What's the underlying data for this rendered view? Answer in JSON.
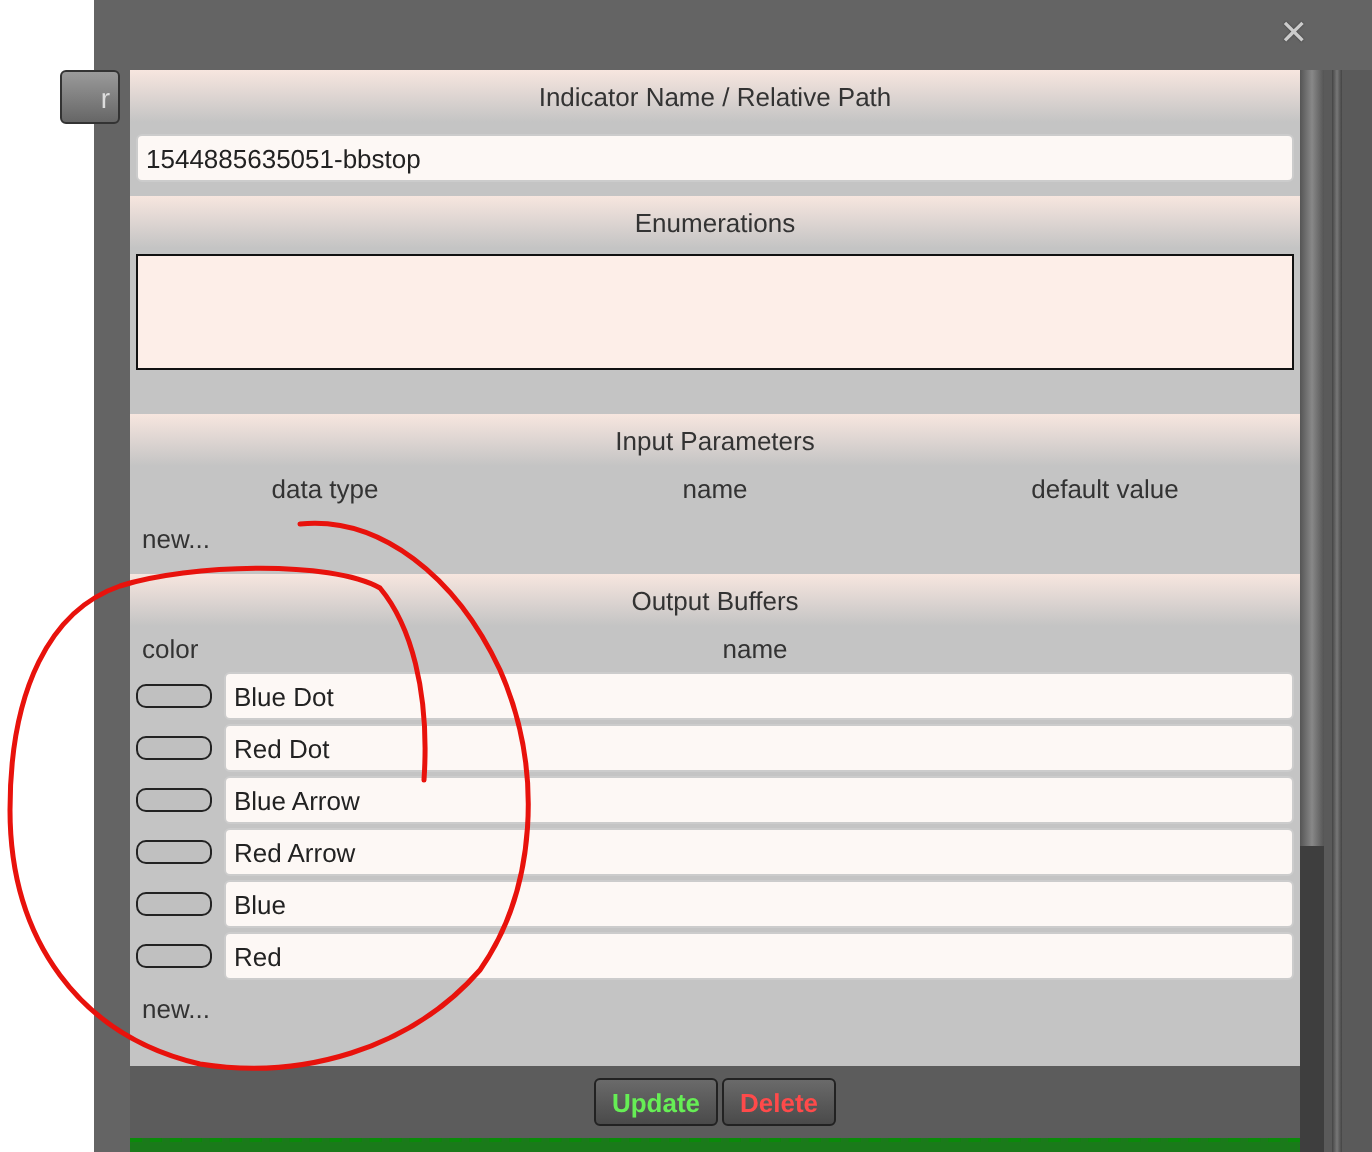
{
  "background_button": {
    "label": "r"
  },
  "dialog": {
    "close": "✕"
  },
  "indicator": {
    "title": "Indicator Name / Relative Path",
    "value": "1544885635051-bbstop"
  },
  "enumerations": {
    "title": "Enumerations"
  },
  "input_parameters": {
    "title": "Input Parameters",
    "columns": [
      "data type",
      "name",
      "default value"
    ],
    "new_link": "new..."
  },
  "output_buffers": {
    "title": "Output Buffers",
    "columns": [
      "color",
      "name"
    ],
    "rows": [
      {
        "name": "Blue Dot"
      },
      {
        "name": "Red Dot"
      },
      {
        "name": "Blue Arrow"
      },
      {
        "name": "Red Arrow"
      },
      {
        "name": "Blue"
      },
      {
        "name": "Red"
      }
    ],
    "new_link": "new..."
  },
  "buttons": [
    {
      "label": "Update",
      "kind": "update"
    },
    {
      "label": "Delete",
      "kind": "delete"
    }
  ]
}
